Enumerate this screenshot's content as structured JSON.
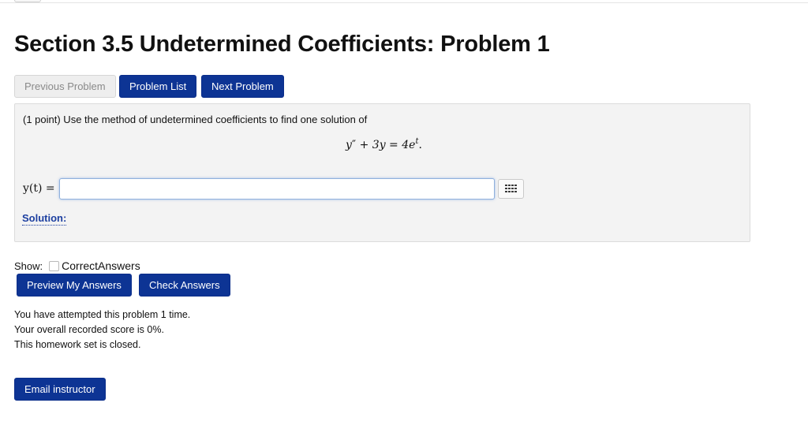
{
  "page": {
    "title": "Section 3.5 Undetermined Coefficients: Problem 1"
  },
  "nav": {
    "previous_label": "Previous Problem",
    "list_label": "Problem List",
    "next_label": "Next Problem"
  },
  "problem": {
    "prompt": "(1 point) Use the method of undetermined coefficients to find one solution of",
    "equation": {
      "lhs_var": "y",
      "lhs_prime": "″",
      "middle": " + 3y = 4e",
      "exp": "t",
      "end": "."
    },
    "answer_label": "y(t) =",
    "answer_value": "",
    "palette_icon": "equation-palette-icon",
    "solution_label": "Solution:"
  },
  "controls": {
    "show_label": "Show:",
    "correct_answers_label": "CorrectAnswers",
    "correct_answers_checked": false,
    "preview_label": "Preview My Answers",
    "check_label": "Check Answers"
  },
  "status": {
    "attempts": "You have attempted this problem 1 time.",
    "score": "Your overall recorded score is 0%.",
    "closed": "This homework set is closed."
  },
  "footer": {
    "email_label": "Email instructor"
  },
  "colors": {
    "primary_button": "#0d3494",
    "disabled_button": "#eeeeee",
    "panel_bg": "#f3f3f3",
    "link": "#1c3fa0"
  }
}
